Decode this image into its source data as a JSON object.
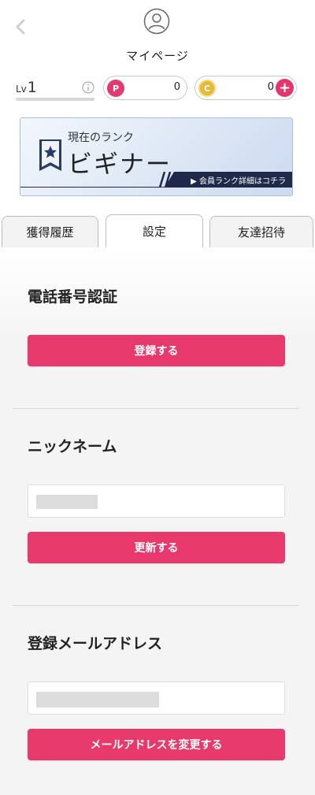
{
  "header": {
    "title": "マイページ"
  },
  "status": {
    "level_prefix": "Lv",
    "level_value": "1",
    "points_badge": "P",
    "points_value": "0",
    "coins_badge": "C",
    "coins_value": "0",
    "add_coins": "+"
  },
  "rank": {
    "caption": "現在のランク",
    "name": "ビギナー",
    "link_label": "▶ 会員ランク詳細はコチラ"
  },
  "tabs": [
    {
      "label": "獲得履歴"
    },
    {
      "label": "設定"
    },
    {
      "label": "友達招待"
    }
  ],
  "sections": {
    "phone": {
      "title": "電話番号認証",
      "button": "登録する"
    },
    "nickname": {
      "title": "ニックネーム",
      "button": "更新する"
    },
    "email": {
      "title": "登録メールアドレス",
      "button": "メールアドレスを変更する"
    }
  },
  "colors": {
    "accent": "#e8396c",
    "rank_card": "#dde7f5",
    "rank_link_bg": "#1f2a4a",
    "coin": "#e7b93a"
  }
}
